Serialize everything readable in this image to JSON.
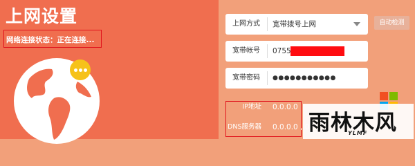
{
  "page": {
    "title": "上网设置",
    "status": "网络连接状态：正在连接..."
  },
  "form": {
    "connection_type": {
      "label": "上网方式",
      "value": "宽带拨号上网"
    },
    "account": {
      "label": "宽带帐号",
      "value": "0755"
    },
    "password": {
      "label": "宽带密码",
      "value": "●●●●●●●●●●●"
    },
    "auto_detect_label": "自动检测"
  },
  "info": {
    "ip": {
      "label": "IP地址",
      "value": "0.0.0.0"
    },
    "dns": {
      "label": "DNS服务器",
      "value": "0.0.0.0 , 0."
    }
  },
  "watermark": {
    "text": "雨林木风",
    "sub": "YLMF"
  },
  "icons": {
    "globe": "globe-icon",
    "badge": "more-icon",
    "dropdown": "chevron-down-icon",
    "windows": "windows-logo-icon"
  },
  "colors": {
    "left_panel": "#f06e4f",
    "background": "#f2a07a",
    "badge": "#f6c21a",
    "highlight_border": "#e0101a"
  }
}
